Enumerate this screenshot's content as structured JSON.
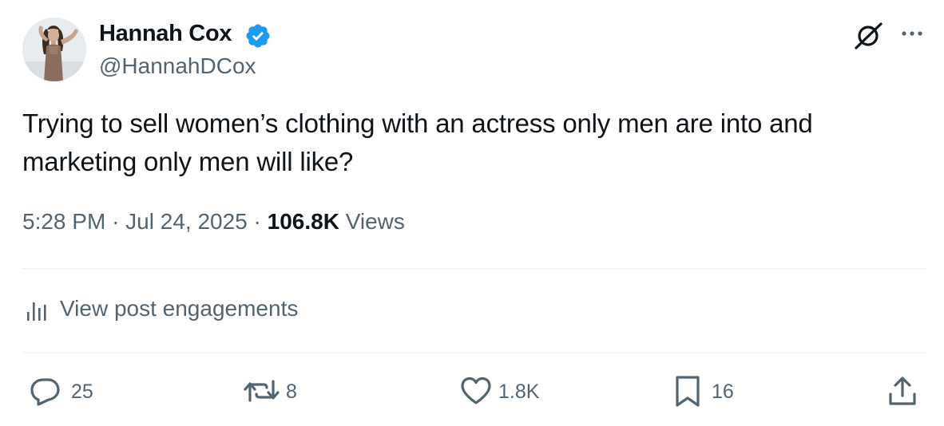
{
  "author": {
    "display_name": "Hannah Cox",
    "handle": "@HannahDCox",
    "verified_badge_color": "#1d9bf0"
  },
  "post": {
    "text": "Trying to sell women’s clothing with an actress only men are into and marketing only men will like?"
  },
  "meta": {
    "time": "5:28 PM",
    "separator1": "·",
    "date": "Jul 24, 2025",
    "separator2": "·",
    "views_count": "106.8K",
    "views_label": "Views"
  },
  "engagements_link": {
    "label": "View post engagements",
    "icon": "analytics-bars-icon"
  },
  "actions": {
    "replies": "25",
    "reposts": "8",
    "likes": "1.8K",
    "bookmarks": "16"
  },
  "icons": {
    "header_right": [
      "grok-icon",
      "more-options-icon"
    ],
    "actions": [
      "reply-icon",
      "repost-icon",
      "like-icon",
      "bookmark-icon",
      "share-icon"
    ]
  },
  "colors": {
    "text_primary": "#0f1419",
    "text_secondary": "#536471",
    "divider": "#eff3f4",
    "verified": "#1d9bf0"
  }
}
